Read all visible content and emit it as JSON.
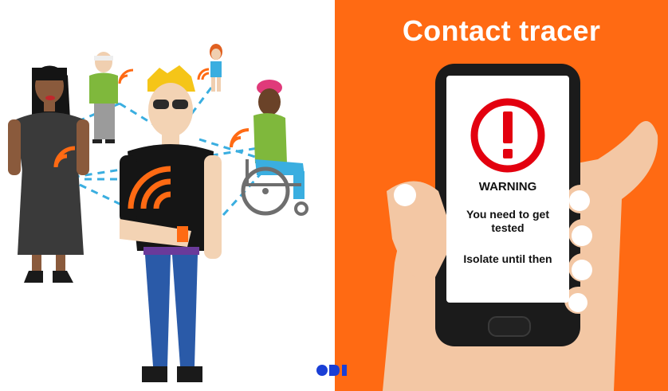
{
  "title": "Contact tracer",
  "phone": {
    "warning": "WARNING",
    "message": "You need to get tested",
    "isolate": "Isolate until then"
  },
  "logo": {
    "name": "ODI"
  },
  "colors": {
    "accent_orange": "#ff6a13",
    "alert_red": "#e3000f",
    "connection_blue": "#3aaee0",
    "phone_body": "#1b1b1b"
  },
  "icons": [
    "alert-icon",
    "wifi-signal-icon",
    "wheelchair-icon",
    "odi-logo"
  ]
}
